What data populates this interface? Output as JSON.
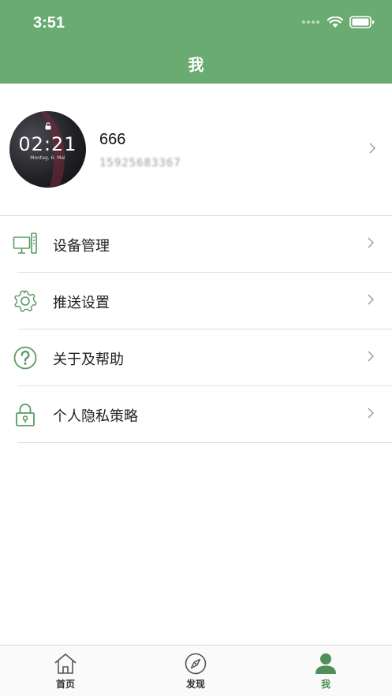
{
  "status_bar": {
    "time": "3:51"
  },
  "header": {
    "title": "我"
  },
  "profile": {
    "avatar": {
      "clock_text": "02:21",
      "date_text": "Montag, 6. Mai"
    },
    "username": "666",
    "phone": "15925683367"
  },
  "menu": {
    "items": [
      {
        "label": "设备管理",
        "icon": "monitor-icon"
      },
      {
        "label": "推送设置",
        "icon": "gear-icon"
      },
      {
        "label": "关于及帮助",
        "icon": "help-circle-icon"
      },
      {
        "label": "个人隐私策略",
        "icon": "lock-icon"
      }
    ]
  },
  "tabbar": {
    "items": [
      {
        "label": "首页",
        "icon": "home-icon"
      },
      {
        "label": "发现",
        "icon": "compass-icon"
      },
      {
        "label": "我",
        "icon": "person-icon",
        "active": true
      }
    ]
  },
  "colors": {
    "brand_green": "#6aab72",
    "active_tab": "#4e8f5a",
    "icon_green": "#5a9a63"
  }
}
